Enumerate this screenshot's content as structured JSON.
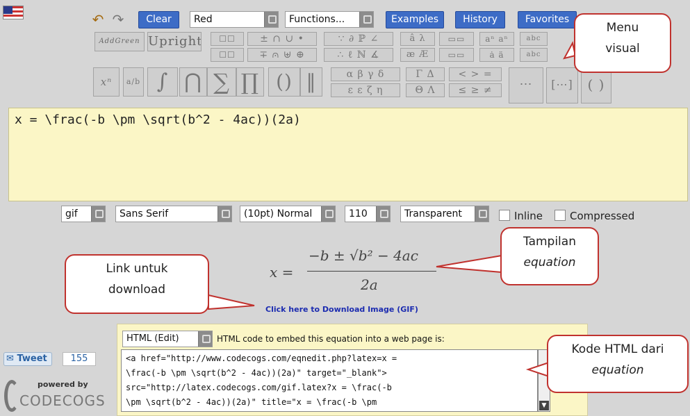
{
  "toolbar": {
    "clear_label": "Clear",
    "color_value": "Red",
    "functions_value": "Functions...",
    "examples_label": "Examples",
    "history_label": "History",
    "favorites_label": "Favorites",
    "addgreen_label": "AddGreen",
    "upright_label": "Upright"
  },
  "palette": {
    "superscript": "xⁿ",
    "fraction": "a/b",
    "integral": "∫",
    "intersect": "⋂",
    "sum": "∑",
    "product": "∏",
    "brackets": "()",
    "bars": "‖",
    "greek_row1": "α β γ δ",
    "greek_row2": "ε ε ζ η",
    "greek_upper_row1": "Γ Δ",
    "greek_upper_row2": "Θ Λ",
    "rel_row1": "< > =",
    "rel_row2": "≤ ≥ ≠",
    "ops_row1": "± ∩ ∪ •",
    "ops_row2": "∓ ⩀ ⊎ ⊕",
    "misc_row1": "∵ ∂ ℙ ∠",
    "misc_row2": "∴ ℓ ℕ ∡",
    "acc_row1": "â λ",
    "acc_row2": "æ Æ",
    "matrix": "⋯",
    "dmatrix": "[⋯]",
    "binom": "( )"
  },
  "editor": {
    "latex": "x = \\frac(-b \\pm \\sqrt(b^2 - 4ac))(2a)"
  },
  "options": {
    "format": "gif",
    "font": "Sans Serif",
    "size": "(10pt) Normal",
    "dpi": "110",
    "background": "Transparent",
    "inline_label": "Inline",
    "compressed_label": "Compressed"
  },
  "preview": {
    "lhs": "x =",
    "numerator": "−b ± √b² − 4ac",
    "denominator": "2a",
    "download_link": "Click here to Download Image (GIF)"
  },
  "embed": {
    "type_value": "HTML (Edit)",
    "caption": "HTML code to embed this equation into a web page is:",
    "code_lines": [
      "<a href=\"http://www.codecogs.com/eqnedit.php?latex=x =",
      "\\frac(-b \\pm \\sqrt(b^2 - 4ac))(2a)\" target=\"_blank\">",
      "src=\"http://latex.codecogs.com/gif.latex?x = \\frac(-b",
      "\\pm \\sqrt(b^2 - 4ac))(2a)\" title=\"x = \\frac(-b \\pm"
    ]
  },
  "social": {
    "tweet_label": "Tweet",
    "tweet_count": "155",
    "powered_by": "powered by",
    "brand": "CODECOGS"
  },
  "callouts": {
    "menu_line1": "Menu",
    "menu_line2": "visual",
    "tampilan_line1": "Tampilan",
    "tampilan_line2": "equation",
    "link_line1": "Link untuk",
    "link_line2": "download",
    "kode_line1": "Kode HTML dari",
    "kode_line2": "equation"
  },
  "colors": {
    "accent_blue": "#3d6cc6",
    "editor_bg": "#fbf6c6",
    "callout_border": "#c0322e"
  }
}
